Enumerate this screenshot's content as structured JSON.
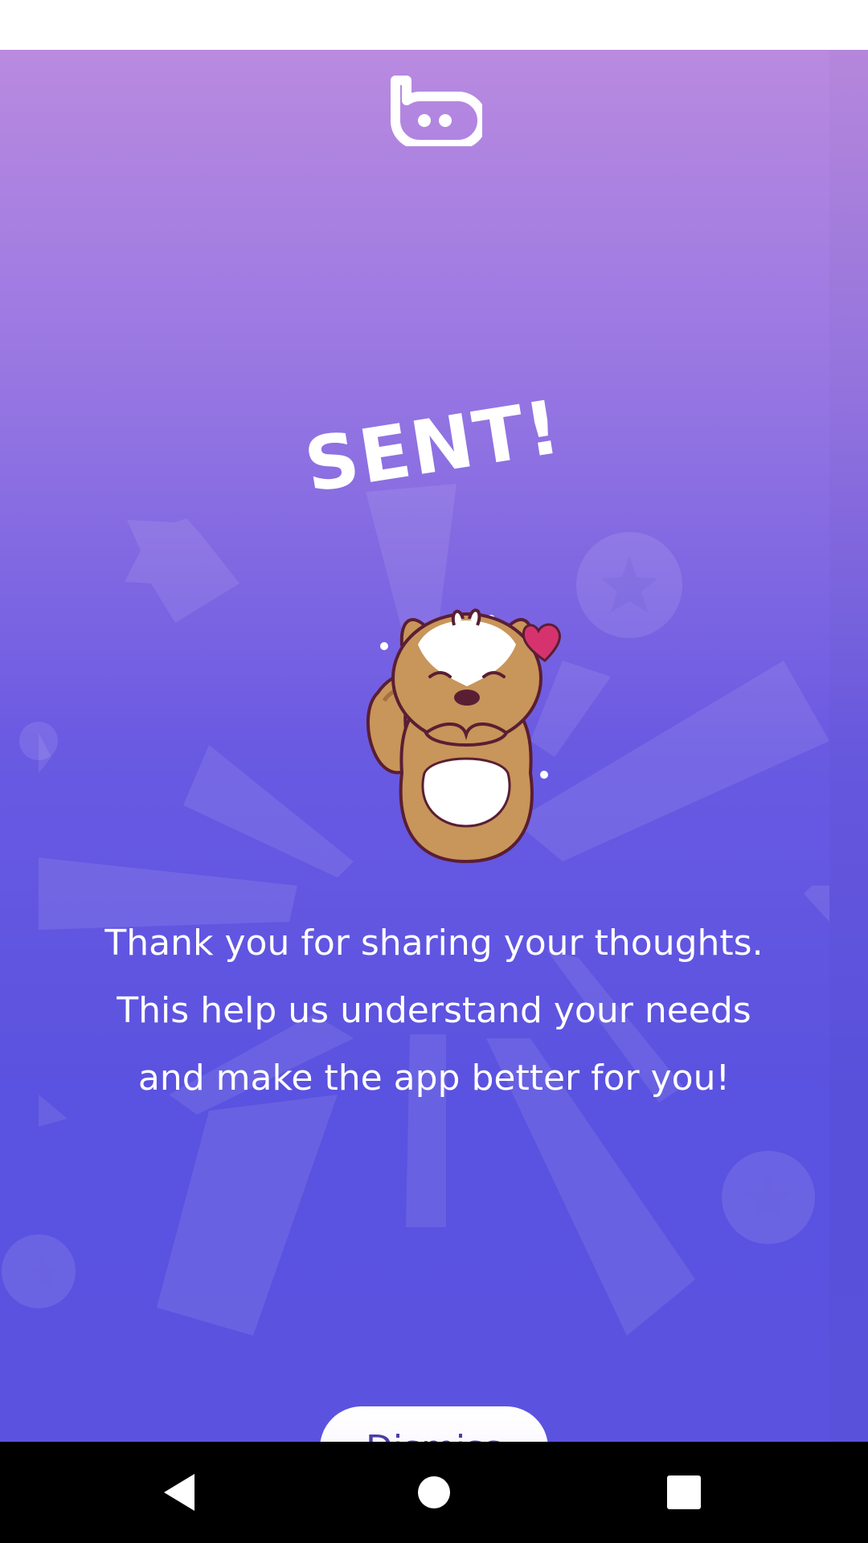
{
  "status_bar": {},
  "header": {
    "logo_icon": "app-logo-icon"
  },
  "main": {
    "title": "SENT!",
    "illustration": "squirrel-mascot-illustration",
    "message": "Thank you for sharing your thoughts. This help us understand your needs and make the app better for you!",
    "dismiss_label": "Dismiss"
  },
  "nav": {
    "back_icon": "back-triangle-icon",
    "home_icon": "home-circle-icon",
    "recents_icon": "recents-square-icon"
  },
  "colors": {
    "gradient_top": "#b98ae0",
    "gradient_bottom": "#5b53df",
    "button_text": "#4a3ca6",
    "heart": "#d6336e",
    "squirrel_fur": "#c8955a"
  }
}
